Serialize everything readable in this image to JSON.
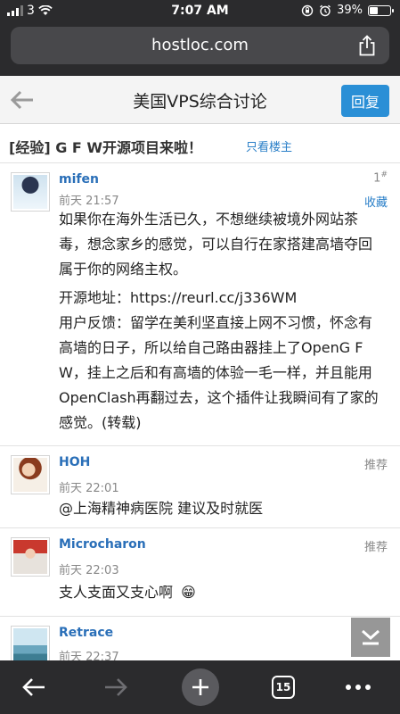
{
  "status_bar": {
    "carrier": "3",
    "time": "7:07 AM",
    "battery": "39%",
    "battery_level": 0.39
  },
  "browser": {
    "url": "hostloc.com"
  },
  "nav": {
    "title": "美国VPS综合讨论",
    "reply_label": "回复"
  },
  "thread": {
    "title": "[经验] G F W开源项目来啦！",
    "owner_only": "只看楼主"
  },
  "posts": [
    {
      "user": "mifen",
      "time": "前天 21:57",
      "floor": "1",
      "floor_mark": "#",
      "fav": "收藏",
      "lines": [
        "如果你在海外生活已久，不想继续被境外网站茶毒，想念家乡的感觉，可以自行在家搭建高墙夺回属于你的网络主权。",
        "开源地址：https://reurl.cc/j336WM",
        "用户反馈：留学在美利坚直接上网不习惯，怀念有高墙的日子，所以给自己路由器挂上了OpenG F W，挂上之后和有高墙的体验一毛一样，并且能用OpenClash再翻过去，这个插件让我瞬间有了家的感觉。(转载)"
      ]
    },
    {
      "user": "HOH",
      "time": "前天 22:01",
      "rec": "推荐",
      "text": "@上海精神病医院 建议及时就医"
    },
    {
      "user": "Microcharon",
      "time": "前天 22:03",
      "rec": "推荐",
      "text": "支人支面又支心啊",
      "emoji": "😁"
    },
    {
      "user": "Retrace",
      "time": "前天 22:37"
    }
  ],
  "toolbar": {
    "tabs": "15"
  }
}
